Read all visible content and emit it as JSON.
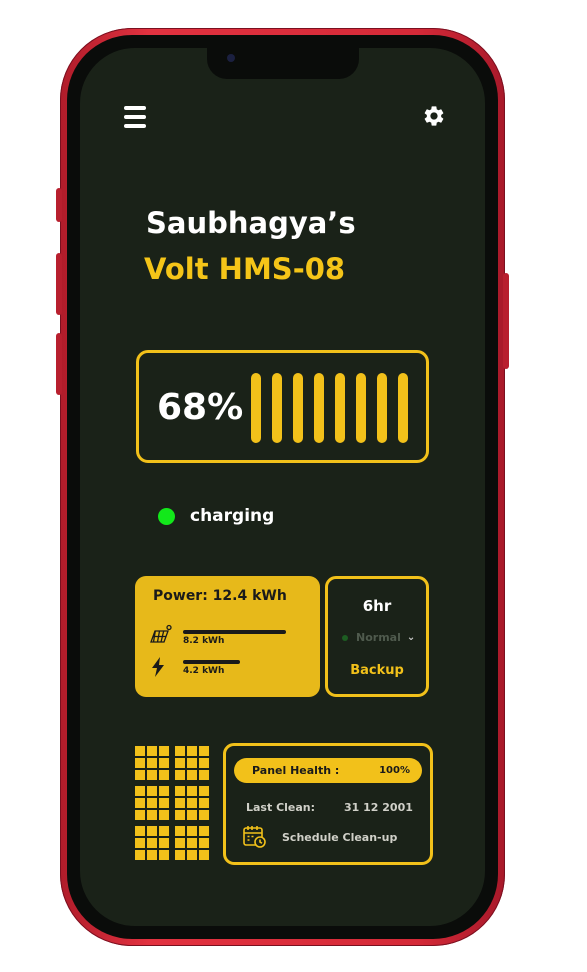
{
  "header": {
    "menu_icon": "hamburger-icon",
    "settings_icon": "gear-icon"
  },
  "owner": {
    "name": "Saubhagya’s",
    "device": "Volt HMS-08"
  },
  "battery": {
    "percent_label": "68%",
    "level": 0.68,
    "segments": 8
  },
  "status": {
    "label": "charging",
    "color": "#12e81a"
  },
  "power": {
    "title": "Power: 12.4 kWh",
    "solar": {
      "label": "8.2 kWh",
      "fraction": 0.66,
      "icon": "solar-panel-icon"
    },
    "grid": {
      "label": "4.2 kWh",
      "fraction": 0.34,
      "icon": "lightning-icon"
    }
  },
  "backup": {
    "duration": "6hr",
    "mode": "Normal",
    "label": "Backup"
  },
  "panel_health": {
    "label": "Panel Health :",
    "value": "100%",
    "last_clean_label": "Last Clean:",
    "last_clean_value": "31 12 2001",
    "schedule_label": "Schedule Clean-up",
    "schedule_icon": "calendar-clock-icon"
  },
  "colors": {
    "accent": "#f2c11a",
    "background": "#1a2218",
    "frame": "#d52a38"
  }
}
